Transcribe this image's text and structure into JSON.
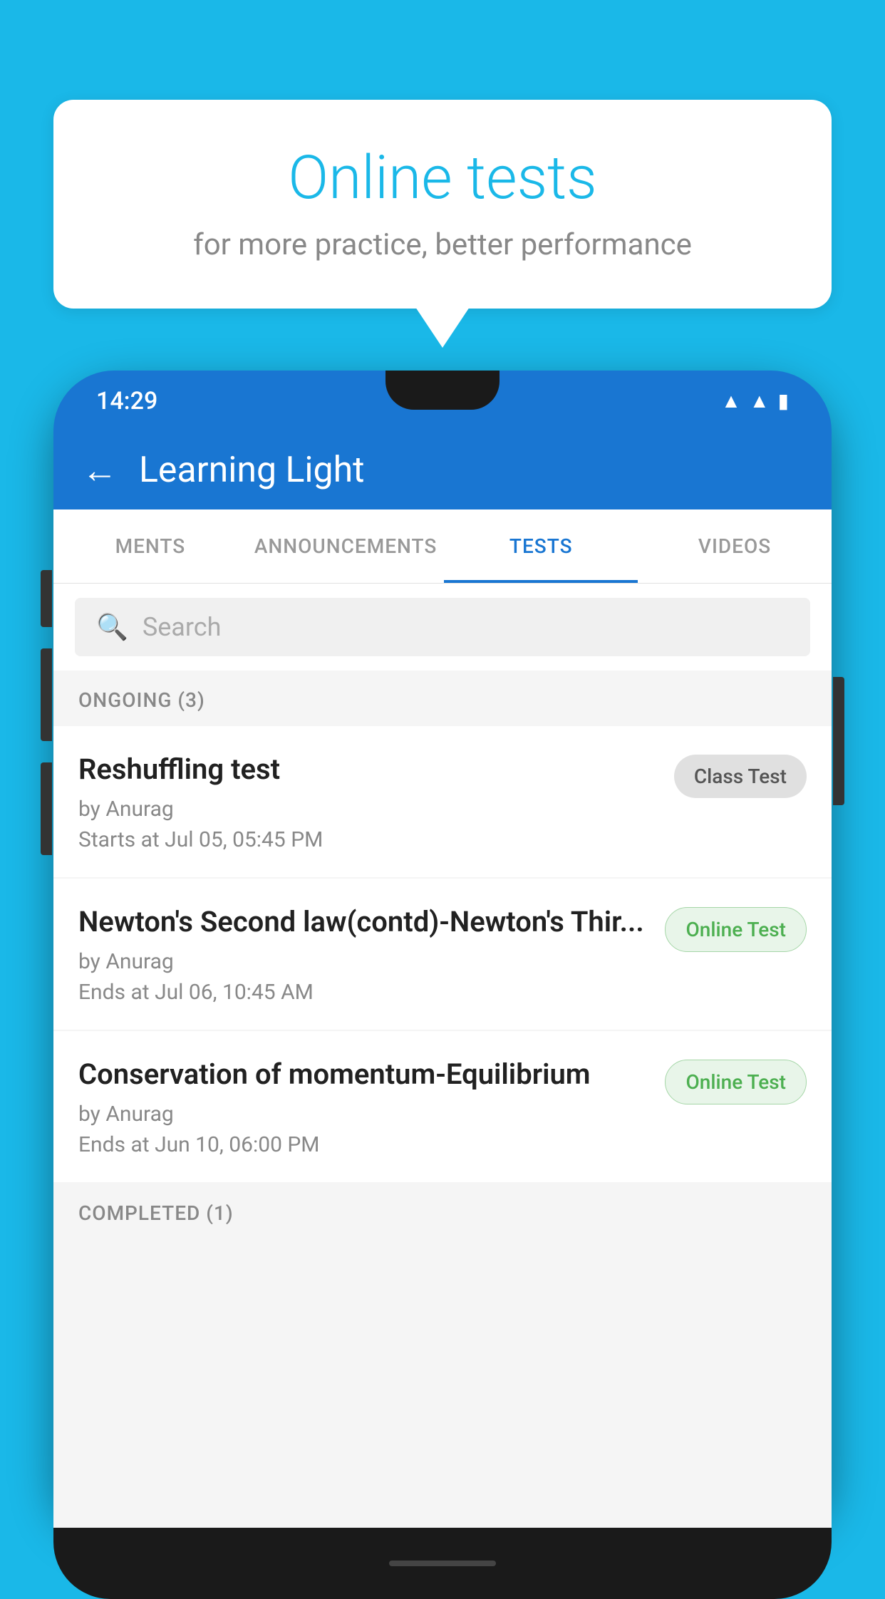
{
  "background_color": "#1ab8e8",
  "speech_bubble": {
    "title": "Online tests",
    "subtitle": "for more practice, better performance"
  },
  "phone": {
    "status_bar": {
      "time": "14:29",
      "wifi_icon": "wifi",
      "signal_icon": "signal",
      "battery_icon": "battery"
    },
    "app_bar": {
      "back_label": "←",
      "title": "Learning Light"
    },
    "tabs": [
      {
        "label": "MENTS",
        "active": false
      },
      {
        "label": "ANNOUNCEMENTS",
        "active": false
      },
      {
        "label": "TESTS",
        "active": true
      },
      {
        "label": "VIDEOS",
        "active": false
      }
    ],
    "search": {
      "placeholder": "Search"
    },
    "ongoing_section": {
      "label": "ONGOING (3)",
      "items": [
        {
          "title": "Reshuffling test",
          "author": "by Anurag",
          "time_label": "Starts at",
          "time": "Jul 05, 05:45 PM",
          "badge": "Class Test",
          "badge_type": "class"
        },
        {
          "title": "Newton's Second law(contd)-Newton's Thir...",
          "author": "by Anurag",
          "time_label": "Ends at",
          "time": "Jul 06, 10:45 AM",
          "badge": "Online Test",
          "badge_type": "online"
        },
        {
          "title": "Conservation of momentum-Equilibrium",
          "author": "by Anurag",
          "time_label": "Ends at",
          "time": "Jun 10, 06:00 PM",
          "badge": "Online Test",
          "badge_type": "online"
        }
      ]
    },
    "completed_section": {
      "label": "COMPLETED (1)"
    }
  }
}
